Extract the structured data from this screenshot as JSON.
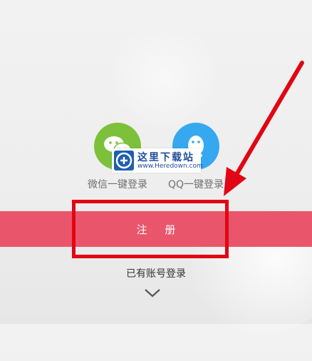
{
  "social_login": {
    "wechat_label": "微信一键登录",
    "qq_label": "QQ一键登录",
    "wechat_icon": "wechat-icon",
    "qq_icon": "qq-penguin-icon"
  },
  "watermark": {
    "title": "这里下载站",
    "url": "www.Heredown.com"
  },
  "register": {
    "label": "注 册"
  },
  "existing_account": {
    "label": "已有账号登录",
    "icon": "chevron-down-icon"
  },
  "colors": {
    "register_button": "#e9556a",
    "wechat": "#7dc13a",
    "qq": "#35a8f0",
    "annotation": "#e10613",
    "background": "#efefef"
  }
}
